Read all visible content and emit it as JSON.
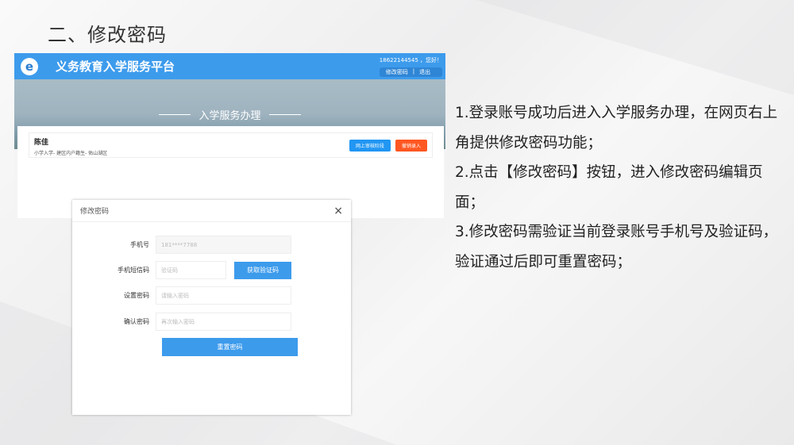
{
  "slide": {
    "title": "二、修改密码"
  },
  "app": {
    "brand": "义务教育入学服务平台",
    "logo_letter": "e",
    "user": "18622144545 ，您好！",
    "change_password_link": "修改密码",
    "separator": "|",
    "logout_link": "退出",
    "banner_title": "入学服务办理"
  },
  "record": {
    "name": "陈佳",
    "path": "小学入学- 建区内户籍生- 佑山湖区",
    "review_button": "网上审核阶段",
    "revoke_button": "撤销录入"
  },
  "modal": {
    "title": "修改密码",
    "close": "×",
    "fields": [
      {
        "label": "手机号",
        "value": "181****7788"
      },
      {
        "label": "手机短信码",
        "placeholder": "验证码",
        "button": "获取验证码"
      },
      {
        "label": "设置密码",
        "placeholder": "请输入密码"
      },
      {
        "label": "确认密码",
        "placeholder": "再次输入密码"
      }
    ],
    "submit": "重置密码"
  },
  "steps": [
    "1.登录账号成功后进入入学服务办理，在网页右上角提供修改密码功能；",
    "2.点击【修改密码】按钮，进入修改密码编辑页面；",
    "3.修改密码需验证当前登录账号手机号及验证码，验证通过后即可重置密码；"
  ]
}
